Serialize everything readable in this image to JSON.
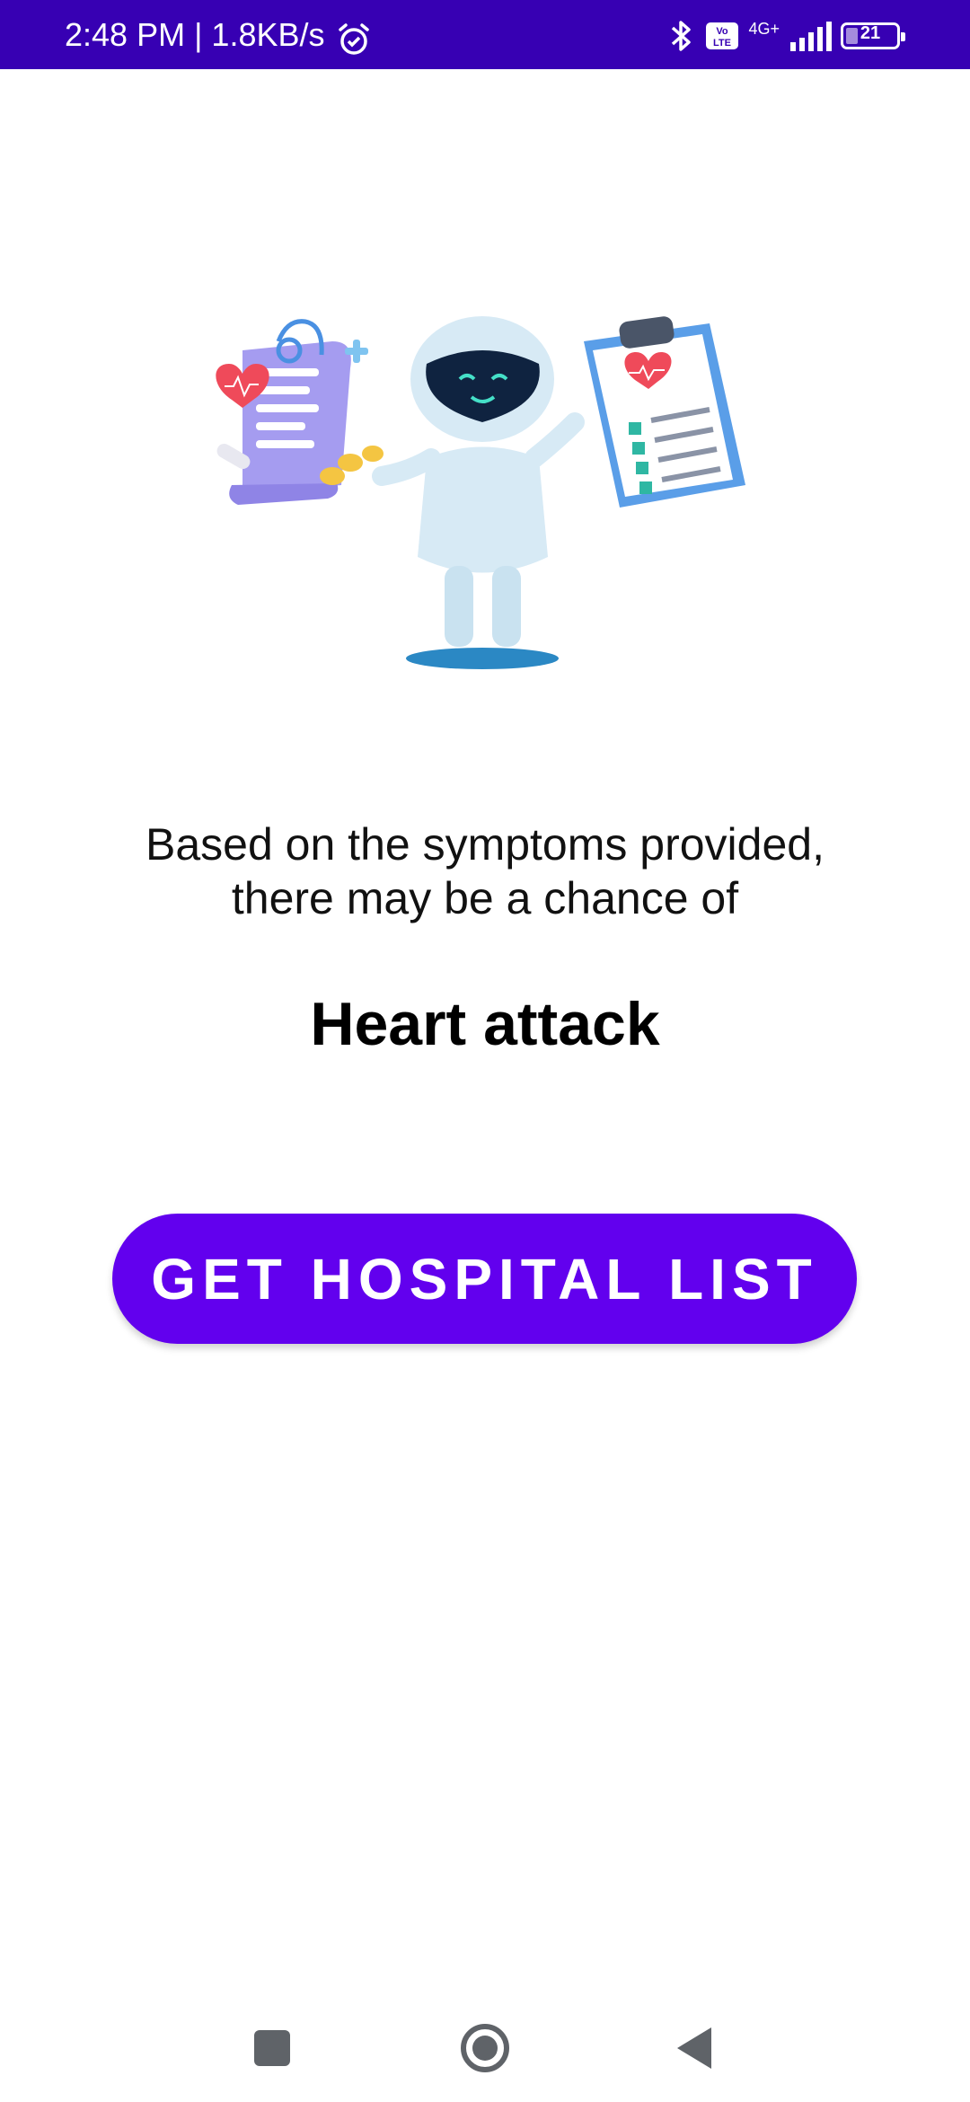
{
  "status_bar": {
    "time_speed": "2:48 PM | 1.8KB/s",
    "network": "4G+",
    "battery_level": "21",
    "icons": [
      "alarm-icon",
      "bluetooth-icon",
      "volte-icon",
      "signal-icon",
      "battery-icon"
    ],
    "background_color": "#3700b3"
  },
  "illustration": {
    "icon": "medical-robot-illustration"
  },
  "result": {
    "message_line1": "Based on the symptoms provided,",
    "message_line2": "there may be a chance of",
    "diagnosis": "Heart attack"
  },
  "actions": {
    "get_hospital_list_label": "GET HOSPITAL LIST",
    "accent_color": "#6200ee"
  },
  "nav_bar": {
    "icons": [
      "recents-icon",
      "home-icon",
      "back-icon"
    ]
  }
}
